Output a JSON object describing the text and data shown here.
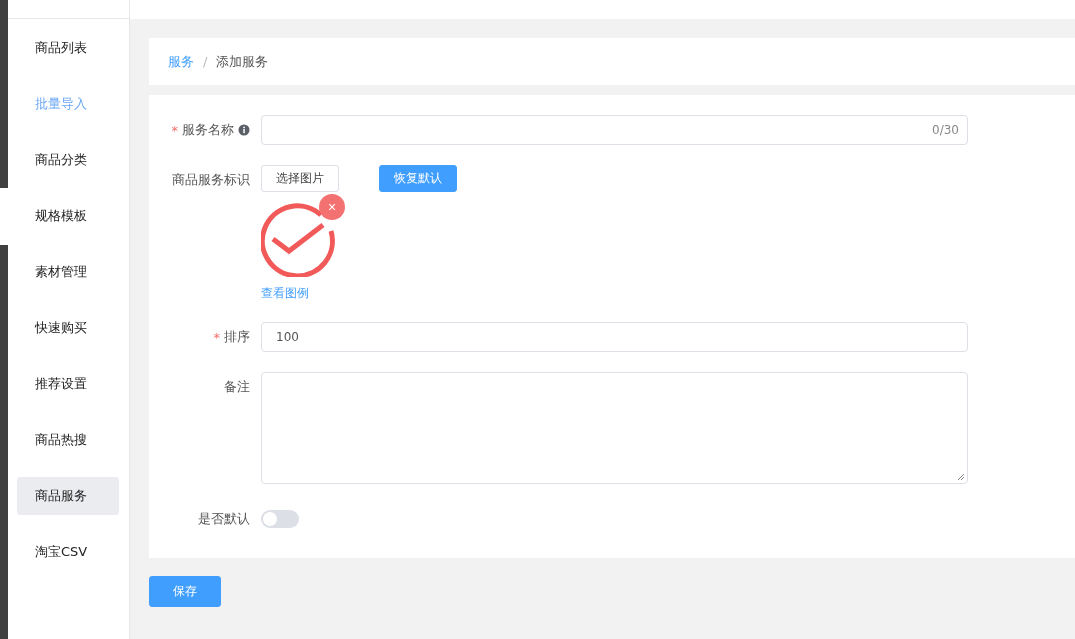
{
  "sidebar": {
    "items": [
      {
        "label": "商品列表",
        "selected": false,
        "hovered": false
      },
      {
        "label": "批量导入",
        "selected": false,
        "hovered": true
      },
      {
        "label": "商品分类",
        "selected": false,
        "hovered": false
      },
      {
        "label": "规格模板",
        "selected": false,
        "hovered": false
      },
      {
        "label": "素材管理",
        "selected": false,
        "hovered": false
      },
      {
        "label": "快速购买",
        "selected": false,
        "hovered": false
      },
      {
        "label": "推荐设置",
        "selected": false,
        "hovered": false
      },
      {
        "label": "商品热搜",
        "selected": false,
        "hovered": false
      },
      {
        "label": "商品服务",
        "selected": true,
        "hovered": false
      },
      {
        "label": "淘宝CSV",
        "selected": false,
        "hovered": false
      }
    ]
  },
  "breadcrumb_separator": "/",
  "required_mark": "*",
  "breadcrumb": [
    {
      "label": "服务",
      "link": true
    },
    {
      "label": "添加服务",
      "link": false
    }
  ],
  "form": {
    "name": {
      "label": "服务名称",
      "required": true,
      "counter": "0/30"
    },
    "icon": {
      "label": "商品服务标识",
      "choose_button": "选择图片",
      "reset_button": "恢复默认",
      "example_link": "查看图例",
      "close": "×"
    },
    "sort": {
      "label": "排序",
      "required": true,
      "value": "100"
    },
    "remark": {
      "label": "备注"
    },
    "default": {
      "label": "是否默认",
      "on": false
    }
  },
  "save_button": "保存"
}
